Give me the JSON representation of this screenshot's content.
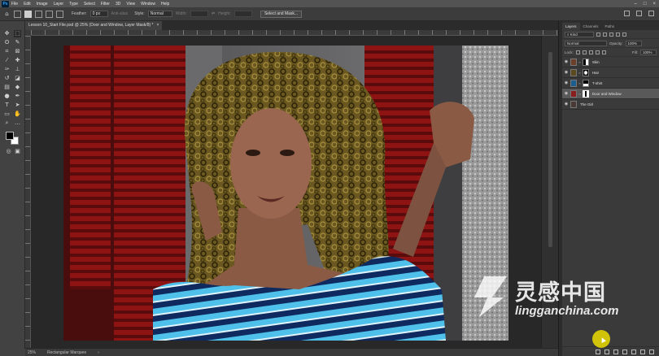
{
  "app": {
    "logo": "Ps",
    "menu": [
      "File",
      "Edit",
      "Image",
      "Layer",
      "Type",
      "Select",
      "Filter",
      "3D",
      "View",
      "Window",
      "Help"
    ]
  },
  "options": {
    "feather_label": "Feather:",
    "feather_value": "0 px",
    "antialias_label": "Anti-alias",
    "style_label": "Style:",
    "style_value": "Normal",
    "width_label": "Width:",
    "height_label": "Height:",
    "select_mask_button": "Select and Mask..."
  },
  "document": {
    "tab_title": "Lesson 10_Start File.psd @ 25% (Door and Window, Layer Mask/8) *",
    "tab_close": "×"
  },
  "statusbar": {
    "zoom": "25%",
    "tool": "Rectangular Marquee"
  },
  "layers_panel": {
    "tabs": [
      "Layers",
      "Channels",
      "Paths"
    ],
    "kind_label": "Kind",
    "blend_mode": "Normal",
    "opacity_label": "Opacity:",
    "opacity_value": "100%",
    "lock_label": "Lock:",
    "fill_label": "Fill:",
    "fill_value": "100%",
    "layers": [
      {
        "name": "Skin",
        "selected": false,
        "thumb_color": "#6b3f2a"
      },
      {
        "name": "Hair",
        "selected": false,
        "thumb_color": "#5a4a1d"
      },
      {
        "name": "T-shirt",
        "selected": false,
        "thumb_color": "#1c5f8f"
      },
      {
        "name": "Door and Window",
        "selected": true,
        "thumb_color": "#8a1d1d"
      },
      {
        "name": "The Girl",
        "selected": false,
        "thumb_color": "#4a3a35"
      }
    ]
  },
  "watermark": {
    "title": "灵感中国",
    "url": "lingganchina.com"
  },
  "colors": {
    "accent": "#31a8ff",
    "cursor_highlight": "#ebdc00"
  }
}
